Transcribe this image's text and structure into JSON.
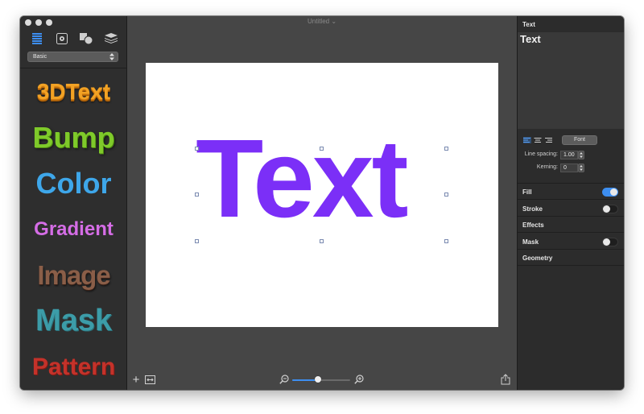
{
  "window": {
    "document_title": "Untitled",
    "title_chevron": "⌄"
  },
  "sidebar": {
    "toolbar_icons": [
      "styles-list-icon",
      "settings-icon",
      "shapes-icon",
      "layers-icon"
    ],
    "preset": {
      "value": "Basic"
    },
    "styles": [
      {
        "label": "3DText"
      },
      {
        "label": "Bump"
      },
      {
        "label": "Color"
      },
      {
        "label": "Gradient"
      },
      {
        "label": "Image"
      },
      {
        "label": "Mask"
      },
      {
        "label": "Pattern"
      }
    ]
  },
  "canvas": {
    "text": "Text",
    "text_color": "#7b2ff7",
    "zoom_fraction": 0.45
  },
  "bottom_bar": {
    "add_label": "+"
  },
  "inspector": {
    "header": "Text",
    "text_value": "Text",
    "font_button": "Font",
    "line_spacing": {
      "label": "Line spacing:",
      "value": "1.00"
    },
    "kerning": {
      "label": "Kerning:",
      "value": "0"
    },
    "sections": {
      "fill": {
        "label": "Fill",
        "enabled": true
      },
      "stroke": {
        "label": "Stroke",
        "enabled": false
      },
      "effects": {
        "label": "Effects"
      },
      "mask": {
        "label": "Mask",
        "enabled": false
      },
      "geometry": {
        "label": "Geometry"
      }
    },
    "accent_color": "#3d8ef0"
  }
}
